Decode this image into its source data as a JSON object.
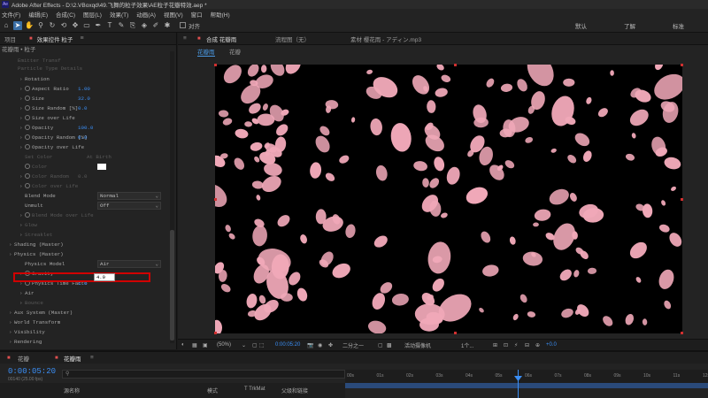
{
  "window": {
    "title": "Adobe After Effects - D:\\2.VBoxqd\\49.飞舞的粒子效果\\AE粒子花瓣特效.aep *",
    "logo": "Ae"
  },
  "menu": [
    "文件(F)",
    "编辑(E)",
    "合成(C)",
    "图层(L)",
    "效果(T)",
    "动画(A)",
    "视图(V)",
    "窗口",
    "帮助(H)"
  ],
  "toolbar": {
    "tools": [
      "home-icon",
      "selection-icon",
      "hand-icon",
      "zoom-icon",
      "rotate-icon",
      "camera-orbit-icon",
      "pan-behind-icon",
      "rectangle-icon",
      "pen-icon",
      "type-icon",
      "brush-icon",
      "clone-icon",
      "eraser-icon",
      "roto-icon",
      "puppet-icon"
    ],
    "snap_label": "对齐",
    "workspaces": [
      "默认",
      "了解",
      "标准"
    ]
  },
  "effects_panel": {
    "tab_project": "项目",
    "tab_effects": "效果控件 粒子",
    "breadcrumb": "花瓣雨 • 粒子",
    "rows": [
      {
        "label": "Rotation",
        "value": "",
        "indent": 2,
        "arrow": true,
        "dim": false,
        "sw": false
      },
      {
        "label": "Aspect Ratio",
        "value": "1.00",
        "indent": 2,
        "arrow": true,
        "dim": false,
        "sw": true
      },
      {
        "label": "Size",
        "value": "32.0",
        "indent": 2,
        "arrow": true,
        "dim": false,
        "sw": true
      },
      {
        "label": "Size Random [%]",
        "value": "0.0",
        "indent": 2,
        "arrow": true,
        "dim": false,
        "sw": true
      },
      {
        "label": "Size over Life",
        "value": "",
        "indent": 2,
        "arrow": true,
        "dim": false,
        "sw": true
      },
      {
        "label": "Opacity",
        "value": "100.0",
        "indent": 2,
        "arrow": true,
        "dim": false,
        "sw": true
      },
      {
        "label": "Opacity Random [%]",
        "value": "0.0",
        "indent": 2,
        "arrow": true,
        "dim": false,
        "sw": true
      },
      {
        "label": "Opacity over Life",
        "value": "",
        "indent": 2,
        "arrow": true,
        "dim": false,
        "sw": true
      },
      {
        "label": "Set Color",
        "value": "At Birth",
        "indent": 2,
        "arrow": false,
        "dim": true,
        "sw": false
      },
      {
        "label": "Color",
        "value": "",
        "indent": 2,
        "arrow": false,
        "dim": true,
        "sw": true
      },
      {
        "label": "Color Random",
        "value": "0.0",
        "indent": 2,
        "arrow": true,
        "dim": true,
        "sw": true
      },
      {
        "label": "Color over Life",
        "value": "",
        "indent": 2,
        "arrow": true,
        "dim": true,
        "sw": true
      },
      {
        "label": "Blend Mode",
        "value": "",
        "indent": 2,
        "arrow": false,
        "dim": false,
        "sw": false
      },
      {
        "label": "Unmult",
        "value": "",
        "indent": 2,
        "arrow": false,
        "dim": false,
        "sw": false
      },
      {
        "label": "Blend Mode over Life",
        "value": "",
        "indent": 2,
        "arrow": true,
        "dim": true,
        "sw": true
      },
      {
        "label": "Glow",
        "value": "",
        "indent": 2,
        "arrow": true,
        "dim": true,
        "sw": false
      },
      {
        "label": "Streaklet",
        "value": "",
        "indent": 2,
        "arrow": true,
        "dim": true,
        "sw": false
      },
      {
        "label": "Shading (Master)",
        "value": "",
        "indent": 1,
        "arrow": true,
        "dim": false,
        "sw": false
      },
      {
        "label": "Physics (Master)",
        "value": "",
        "indent": 1,
        "arrow": true,
        "dim": false,
        "sw": false
      },
      {
        "label": "Physics Model",
        "value": "",
        "indent": 2,
        "arrow": false,
        "dim": false,
        "sw": false
      },
      {
        "label": "Gravity",
        "value": "",
        "indent": 2,
        "arrow": true,
        "dim": false,
        "sw": true
      },
      {
        "label": "Physics Time Facto",
        "value": "1.0",
        "indent": 2,
        "arrow": true,
        "dim": false,
        "sw": true
      },
      {
        "label": "Air",
        "value": "",
        "indent": 2,
        "arrow": true,
        "dim": false,
        "sw": false
      },
      {
        "label": "Bounce",
        "value": "",
        "indent": 2,
        "arrow": true,
        "dim": true,
        "sw": false
      },
      {
        "label": "Aux System (Master)",
        "value": "",
        "indent": 1,
        "arrow": true,
        "dim": false,
        "sw": false
      },
      {
        "label": "World Transform",
        "value": "",
        "indent": 1,
        "arrow": true,
        "dim": false,
        "sw": false
      },
      {
        "label": "Visibility",
        "value": "",
        "indent": 1,
        "arrow": true,
        "dim": false,
        "sw": false
      },
      {
        "label": "Rendering",
        "value": "",
        "indent": 1,
        "arrow": true,
        "dim": false,
        "sw": false
      }
    ],
    "top_faded_row": "Emitter Transf",
    "top_faded_row2": "Particle Type Details",
    "blend_mode_value": "Normal",
    "unmult_value": "Off",
    "physics_model_value": "Air",
    "set_color_value": "At Birth",
    "gravity_value": "4.0",
    "color_swatch": "#ffffff"
  },
  "comp_panel": {
    "tab_comp": "合成 花瓣雨",
    "tab_flow": "流程图（无）",
    "tab_layer": "素材 樱花雨 - アディン.mp3",
    "subtab_1": "花瓣雨",
    "subtab_2": "花瓣"
  },
  "viewer_footer": {
    "zoom": "(50%)",
    "timecode": "0:00:05:20",
    "resolution": "二分之一",
    "camera": "活动摄像机",
    "views": "1个...",
    "exposure": "+0.0"
  },
  "timeline": {
    "tab_1": "花瓣",
    "tab_2": "花瓣雨",
    "timecode": "0:00:05:20",
    "timecode_sub": "00140 (25.00 fps)",
    "headers": [
      "源名称",
      "模式",
      "T TrkMat",
      "父级和链接"
    ],
    "ruler": [
      "00s",
      "01s",
      "02s",
      "03s",
      "04s",
      "05s",
      "06s",
      "07s",
      "08s",
      "09s",
      "10s",
      "11s",
      "12s"
    ]
  },
  "colors": {
    "accent_blue": "#3a8ef5",
    "highlight_red": "#d00000",
    "petal_pink": "#f0a8b8",
    "viewer_bg": "#000000"
  }
}
